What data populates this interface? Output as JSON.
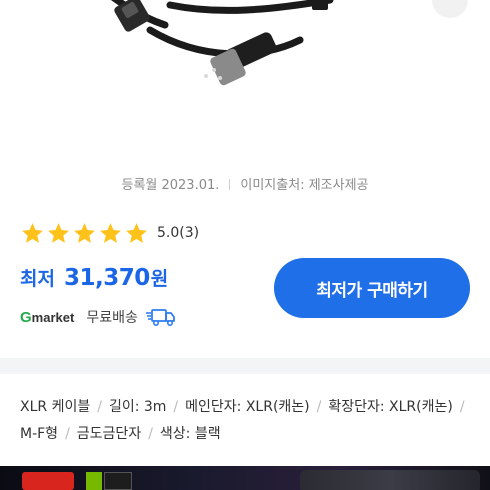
{
  "product_image": {
    "alt": "XLR cable product photo"
  },
  "meta": {
    "registered": "등록월 2023.01.",
    "image_source": "이미지출처: 제조사제공"
  },
  "rating": {
    "score": "5.0",
    "count": "(3)",
    "stars": 5
  },
  "price": {
    "label": "최저",
    "value": "31,370",
    "unit": "원"
  },
  "seller": {
    "mall": "Gmarket",
    "shipping": "무료배송"
  },
  "buy_button": {
    "label": "최저가 구매하기"
  },
  "specs": [
    "XLR 케이블",
    "길이: 3m",
    "메인단자: XLR(캐논)",
    "확장단자: XLR(캐논)",
    "M-F형",
    "금도금단자",
    "색상: 블랙"
  ],
  "colors": {
    "accent": "#1f6fe8",
    "price": "#1a66e6",
    "star": "#ffc21a"
  },
  "icons": [
    "star-icon",
    "gmarket-logo",
    "truck-icon"
  ]
}
